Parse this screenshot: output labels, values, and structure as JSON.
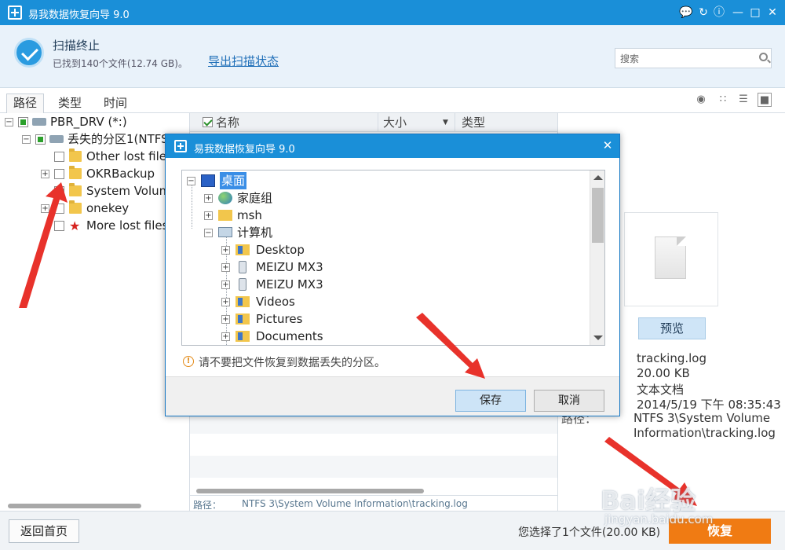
{
  "window": {
    "title": "易我数据恢复向导 9.0"
  },
  "header": {
    "status_title": "扫描终止",
    "status_sub": "已找到140个文件(12.74 GB)。",
    "export_link": "导出扫描状态",
    "search_placeholder": "搜索"
  },
  "tabs": [
    {
      "label": "路径"
    },
    {
      "label": "类型"
    },
    {
      "label": "时间"
    }
  ],
  "tree": {
    "items": [
      {
        "label": "PBR_DRV (*:)"
      },
      {
        "label": "丢失的分区1(NTFS"
      },
      {
        "label": "Other lost files"
      },
      {
        "label": "OKRBackup"
      },
      {
        "label": "System Volume"
      },
      {
        "label": "onekey"
      },
      {
        "label": "More lost files"
      }
    ]
  },
  "list": {
    "columns": [
      {
        "label": "名称"
      },
      {
        "label": "大小"
      },
      {
        "label": "类型"
      }
    ],
    "path_label": "路径：",
    "path_value": "NTFS 3\\System Volume Information\\tracking.log"
  },
  "preview": {
    "button": "预览",
    "filename": "tracking.log",
    "size": "20.00 KB",
    "type": "文本文档",
    "date": "2014/5/19 下午 08:35:43",
    "path_label": "路径：",
    "path_line1": "NTFS 3\\System Volume",
    "path_line2": "Information\\tracking.log"
  },
  "footer": {
    "home_button": "返回首页",
    "selected_info": "您选择了1个文件(20.00 KB)",
    "recover_button": "恢复"
  },
  "dialog": {
    "title": "易我数据恢复向导 9.0",
    "tree": [
      {
        "label": "桌面"
      },
      {
        "label": "家庭组"
      },
      {
        "label": "msh"
      },
      {
        "label": "计算机"
      },
      {
        "label": "Desktop"
      },
      {
        "label": "MEIZU MX3"
      },
      {
        "label": "MEIZU MX3"
      },
      {
        "label": "Videos"
      },
      {
        "label": "Pictures"
      },
      {
        "label": "Documents"
      }
    ],
    "warning": "请不要把文件恢复到数据丢失的分区。",
    "save_button": "保存",
    "cancel_button": "取消"
  },
  "watermark": {
    "brand": "Bai经验",
    "url": "jingyan.baidu.com"
  },
  "colors": {
    "accent": "#1a8fd8",
    "recover": "#f07b13",
    "annotation": "#e8322b"
  }
}
